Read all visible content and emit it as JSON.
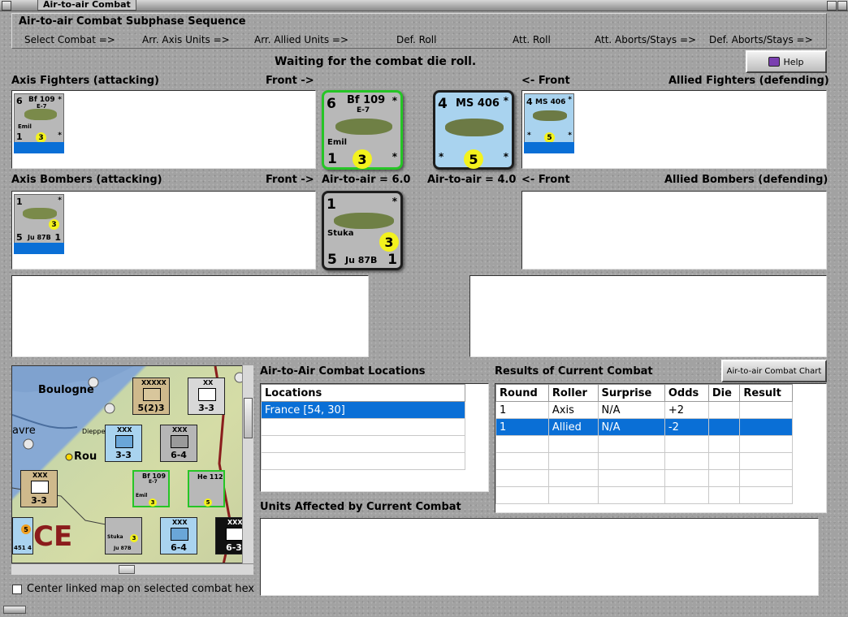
{
  "window": {
    "title": "Air-to-air Combat"
  },
  "sequence": {
    "title": "Air-to-air Combat Subphase Sequence",
    "steps": [
      "Select Combat =>",
      "Arr. Axis Units =>",
      "Arr. Allied Units =>",
      "Def. Roll",
      "Att. Roll",
      "Att. Aborts/Stays =>",
      "Def. Aborts/Stays =>"
    ]
  },
  "status": "Waiting for the combat die roll.",
  "help_button": "Help",
  "labels": {
    "axis_fighters": "Axis Fighters (attacking)",
    "front_right": "Front ->",
    "front_left": "<- Front",
    "allied_fighters": "Allied Fighters (defending)",
    "axis_bombers": "Axis Bombers (attacking)",
    "allied_bombers": "Allied Bombers (defending)",
    "axis_air_to_air": "Air-to-air = 6.0",
    "allied_air_to_air": "Air-to-air = 4.0"
  },
  "units": {
    "bf109": {
      "name": "Bf 109",
      "variant": "E-7",
      "pilot": "Emil",
      "top_left": "6",
      "bottom_left": "1",
      "value": "3",
      "star": "*"
    },
    "ms406": {
      "name": "MS 406",
      "top_left": "4",
      "value": "5",
      "star": "*"
    },
    "ju87": {
      "name": "Ju 87B",
      "pilot": "Stuka",
      "top_left": "1",
      "bottom_left": "5",
      "bottom_right": "1",
      "value": "3",
      "star": "*"
    }
  },
  "map": {
    "places": [
      "Boulogne",
      "avre",
      "Dieppe",
      "Rou",
      "CE"
    ],
    "counters": {
      "xxxxx": "XXXXX",
      "c1": "5(2)3",
      "xx": "XX",
      "c2": "3-3",
      "xxx": "XXX",
      "c3": "3-3",
      "c4": "6-4",
      "c5": "3-3",
      "c6": "6-4",
      "c7": "6-3",
      "he112": "He 112",
      "bf109": "Bf 109",
      "e7": "E-7",
      "emil": "Emil",
      "stuka": "Stuka",
      "ju87b": "Ju 87B",
      "c8": "451 4",
      "n2": "2",
      "n3": "3",
      "n5": "5",
      "n6": "6",
      "n3b": "3",
      "n4": "4"
    }
  },
  "center_linked_map": "Center linked map on selected combat hex",
  "locations": {
    "title": "Air-to-Air Combat Locations",
    "header": "Locations",
    "rows": [
      "France [54, 30]"
    ]
  },
  "results": {
    "title": "Results of Current Combat",
    "chart_button": "Air-to-air Combat Chart",
    "columns": [
      "Round",
      "Roller",
      "Surprise",
      "Odds",
      "Die",
      "Result"
    ],
    "rows": [
      [
        "1",
        "Axis",
        "N/A",
        "+2",
        "",
        ""
      ],
      [
        "1",
        "Allied",
        "N/A",
        "-2",
        "",
        ""
      ]
    ]
  },
  "units_affected_title": "Units Affected by Current Combat",
  "colors": {
    "selection": "#0a6fd6",
    "counter_axis": "#b8b8b8",
    "counter_allied": "#a9d3ef",
    "die_value": "#f3f21e"
  }
}
